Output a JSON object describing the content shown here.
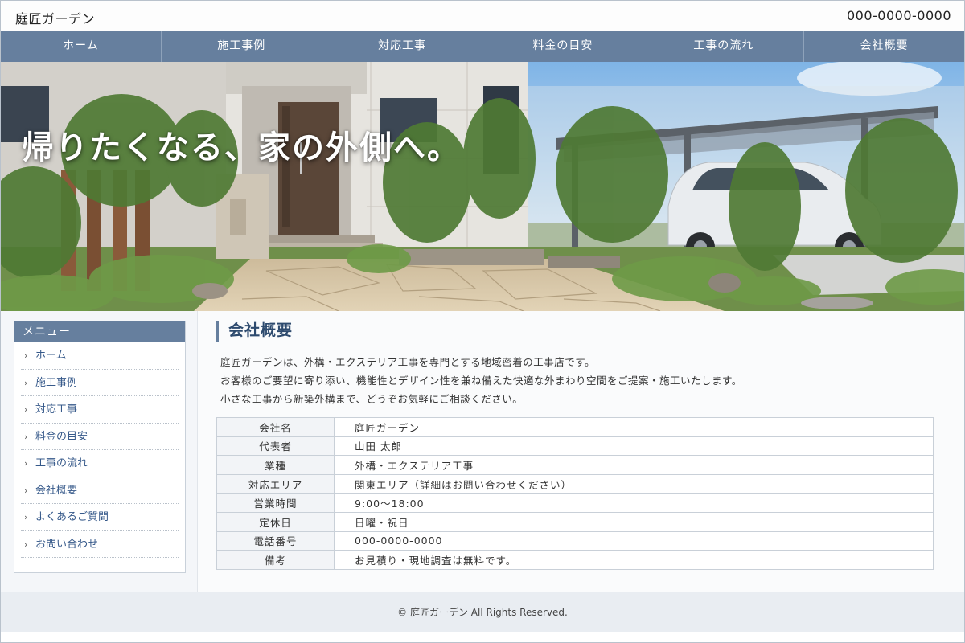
{
  "header": {
    "site_name": "庭匠ガーデン",
    "phone": "000-0000-0000"
  },
  "nav": {
    "items": [
      {
        "label": "ホーム"
      },
      {
        "label": "施工事例"
      },
      {
        "label": "対応工事"
      },
      {
        "label": "料金の目安"
      },
      {
        "label": "工事の流れ"
      },
      {
        "label": "会社概要"
      }
    ]
  },
  "hero": {
    "catch_copy": "帰りたくなる、家の外側へ。"
  },
  "sidebar": {
    "title": "メニュー",
    "items": [
      {
        "label": "ホーム"
      },
      {
        "label": "施工事例"
      },
      {
        "label": "対応工事"
      },
      {
        "label": "料金の目安"
      },
      {
        "label": "工事の流れ"
      },
      {
        "label": "会社概要"
      },
      {
        "label": "よくあるご質問"
      },
      {
        "label": "お問い合わせ"
      }
    ]
  },
  "main": {
    "title": "会社概要",
    "intro": [
      "庭匠ガーデンは、外構・エクステリア工事を専門とする地域密着の工事店です。",
      "お客様のご要望に寄り添い、機能性とデザイン性を兼ね備えた快適な外まわり空間をご提案・施工いたします。",
      "小さな工事から新築外構まで、どうぞお気軽にご相談ください。"
    ],
    "company_table": [
      {
        "label": "会社名",
        "value": "庭匠ガーデン"
      },
      {
        "label": "代表者",
        "value": "山田 太郎"
      },
      {
        "label": "業種",
        "value": "外構・エクステリア工事"
      },
      {
        "label": "対応エリア",
        "value": "関東エリア（詳細はお問い合わせください）"
      },
      {
        "label": "営業時間",
        "value": "9:00〜18:00"
      },
      {
        "label": "定休日",
        "value": "日曜・祝日"
      },
      {
        "label": "電話番号",
        "value": "000-0000-0000"
      },
      {
        "label": "備考",
        "value": "お見積り・現地調査は無料です。"
      }
    ]
  },
  "footer": {
    "copyright": "© 庭匠ガーデン All Rights Reserved."
  },
  "colors": {
    "nav_bg": "#667f9e",
    "title_text": "#2d4a6e",
    "link_text": "#36598a"
  }
}
